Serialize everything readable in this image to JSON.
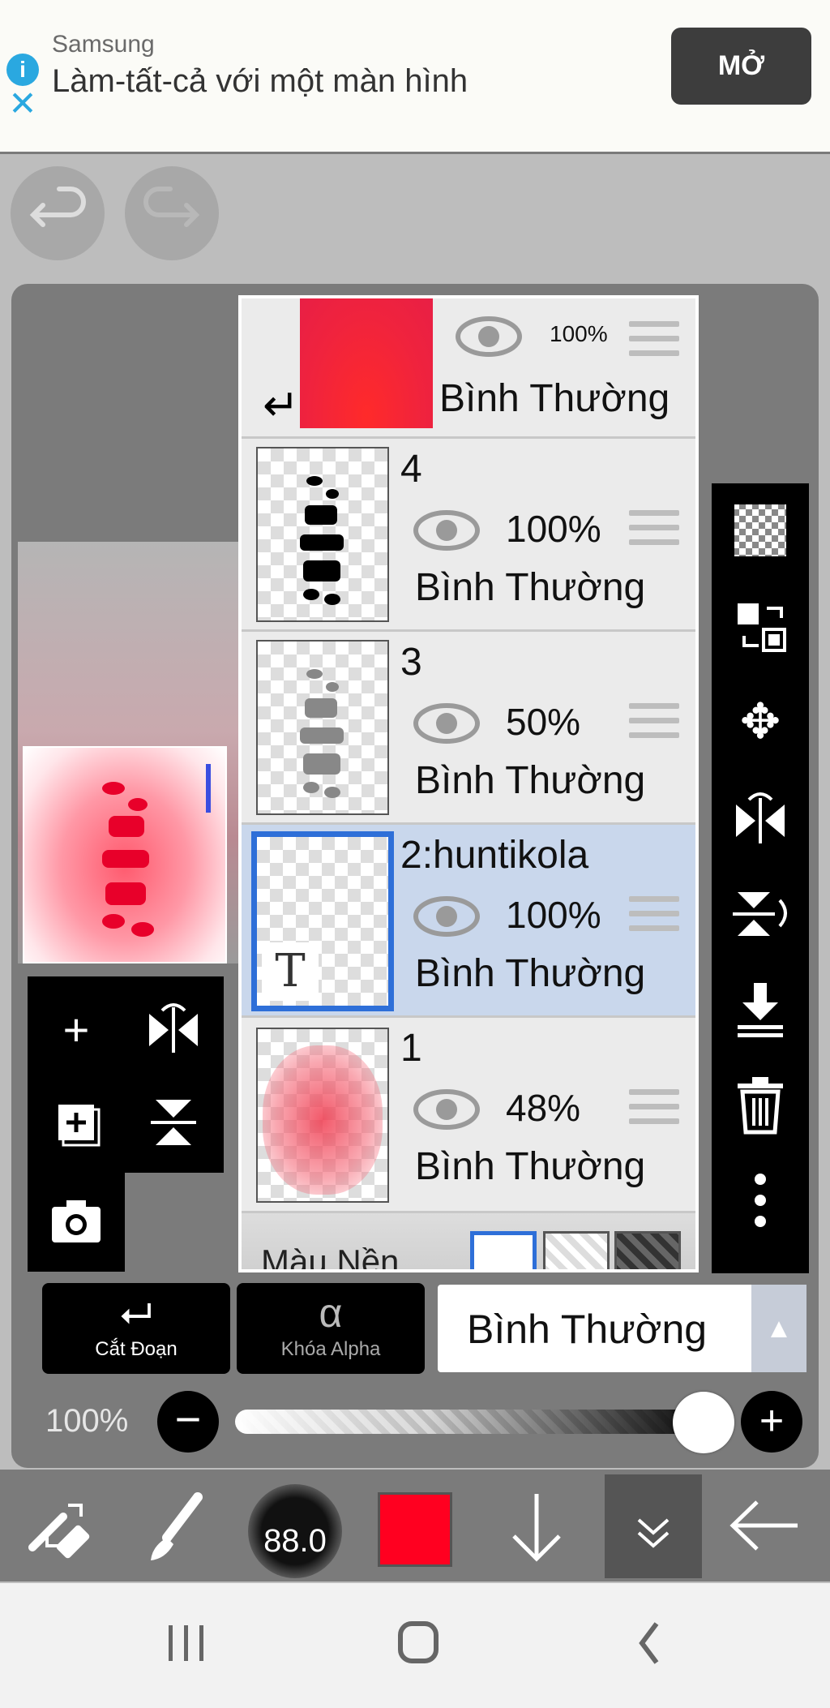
{
  "ad": {
    "brand": "Samsung",
    "headline": "Làm-tất-cả với một màn hình",
    "open_label": "MỞ",
    "info_icon": "info-icon",
    "close_icon": "close-icon"
  },
  "layers": {
    "items": [
      {
        "name": "",
        "opacity": "100%",
        "mode": "Bình Thường",
        "visible": true
      },
      {
        "name": "4",
        "opacity": "100%",
        "mode": "Bình Thường",
        "visible": true
      },
      {
        "name": "3",
        "opacity": "50%",
        "mode": "Bình Thường",
        "visible": true
      },
      {
        "name": "2:huntikola",
        "opacity": "100%",
        "mode": "Bình Thường",
        "visible": true,
        "selected": true,
        "type_badge": "T"
      },
      {
        "name": "1",
        "opacity": "48%",
        "mode": "Bình Thường",
        "visible": true
      }
    ],
    "background_label": "Màu Nền"
  },
  "controls": {
    "cut_label": "Cắt Đoạn",
    "alpha_label": "Khóa Alpha",
    "alpha_symbol": "α",
    "blend_mode": "Bình Thường",
    "opacity_label": "100%",
    "opacity_value": 1.0
  },
  "bottombar": {
    "brush_size": "88.0",
    "color": "#ff0020"
  }
}
